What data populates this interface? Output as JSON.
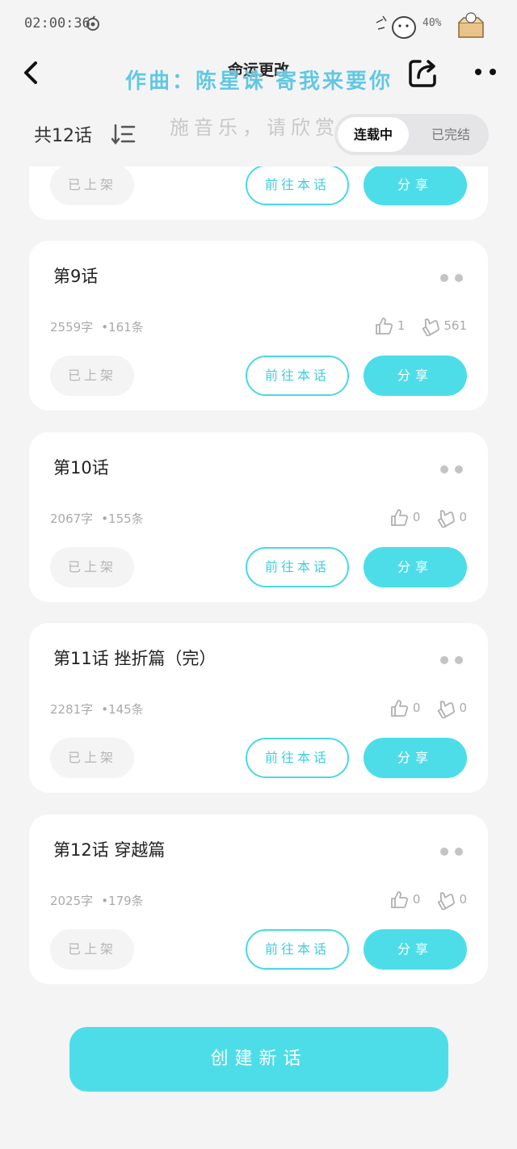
{
  "status_bar": {
    "time": "02:00:36",
    "battery": "40%"
  },
  "header": {
    "title": "命运更改"
  },
  "overlay": {
    "line1": "作曲：陈星诛 寄我来要你",
    "line2": "施音乐，请欣赏"
  },
  "toolbar": {
    "count_label": "共12话",
    "tabs": [
      {
        "label": "连载中",
        "active": true
      },
      {
        "label": "已完结",
        "active": false
      }
    ]
  },
  "partial_card": {
    "status_label": "已上架",
    "goto_label": "前往本话",
    "share_label": "分享"
  },
  "episodes": [
    {
      "title": "第9话",
      "words": "2559字",
      "comments": "•161条",
      "likes": "1",
      "dislikes": "561",
      "status_label": "已上架",
      "goto_label": "前往本话",
      "share_label": "分享"
    },
    {
      "title": "第10话",
      "words": "2067字",
      "comments": "•155条",
      "likes": "0",
      "dislikes": "0",
      "status_label": "已上架",
      "goto_label": "前往本话",
      "share_label": "分享"
    },
    {
      "title": "第11话  挫折篇（完）",
      "words": "2281字",
      "comments": "•145条",
      "likes": "0",
      "dislikes": "0",
      "status_label": "已上架",
      "goto_label": "前往本话",
      "share_label": "分享"
    },
    {
      "title": "第12话  穿越篇",
      "words": "2025字",
      "comments": "•179条",
      "likes": "0",
      "dislikes": "0",
      "status_label": "已上架",
      "goto_label": "前往本话",
      "share_label": "分享"
    }
  ],
  "create_button": {
    "label": "创建新话"
  },
  "colors": {
    "accent": "#4ddde9",
    "accent_text": "#3fcfe0",
    "overlay_text": "#63c7e3",
    "background": "#f4f4f5"
  },
  "icons": [
    "back-icon",
    "share-icon",
    "more-icon",
    "sort-icon",
    "thumbs-up-icon",
    "thumbs-down-icon"
  ]
}
